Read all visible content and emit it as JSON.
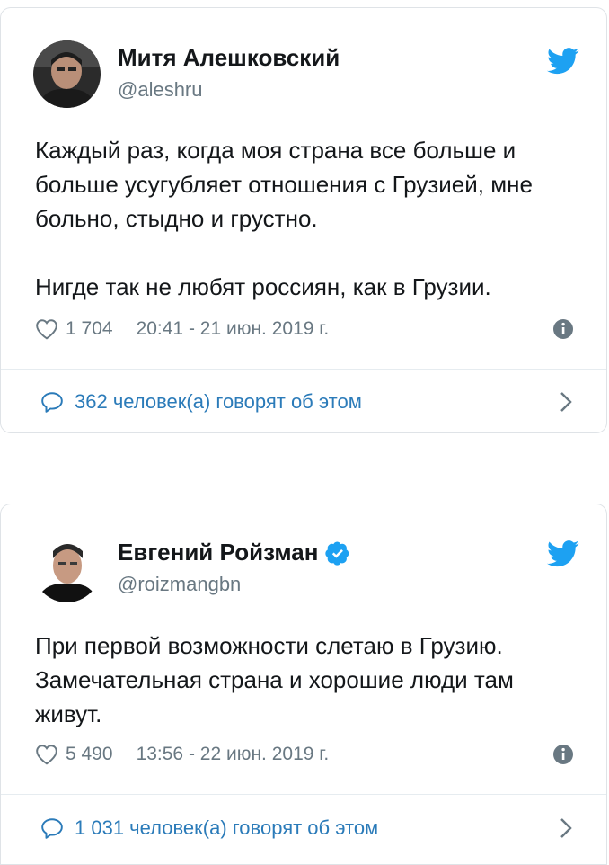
{
  "tweets": [
    {
      "author_name": "Митя Алешковский",
      "handle": "@aleshru",
      "verified": false,
      "text": "Каждый раз, когда моя страна все больше и\nбольше усугубляет отношения с Грузией, мне\nбольно, стыдно и грустно.\n\nНигде так не любят россиян, как в Грузии.",
      "likes": "1 704",
      "timestamp": "20:41 - 21 июн. 2019 г.",
      "replies_label": "362 человек(а) говорят об этом"
    },
    {
      "author_name": "Евгений Ройзман",
      "handle": "@roizmangbn",
      "verified": true,
      "text": "При первой возможности слетаю в Грузию.\nЗамечательная страна и хорошие люди там\nживут.",
      "likes": "5 490",
      "timestamp": "13:56 - 22 июн. 2019 г.",
      "replies_label": "1 031 человек(а) говорят об этом"
    }
  ],
  "colors": {
    "twitter_blue": "#1da1f2",
    "link_blue": "#2b7bb9",
    "meta_gray": "#697882",
    "border": "#dfe3e7"
  },
  "icons": {
    "bird": "twitter-bird-icon",
    "heart": "heart-outline-icon",
    "info": "info-icon",
    "reply": "reply-bubble-icon",
    "chevron": "chevron-right-icon",
    "verified": "verified-badge-icon"
  }
}
